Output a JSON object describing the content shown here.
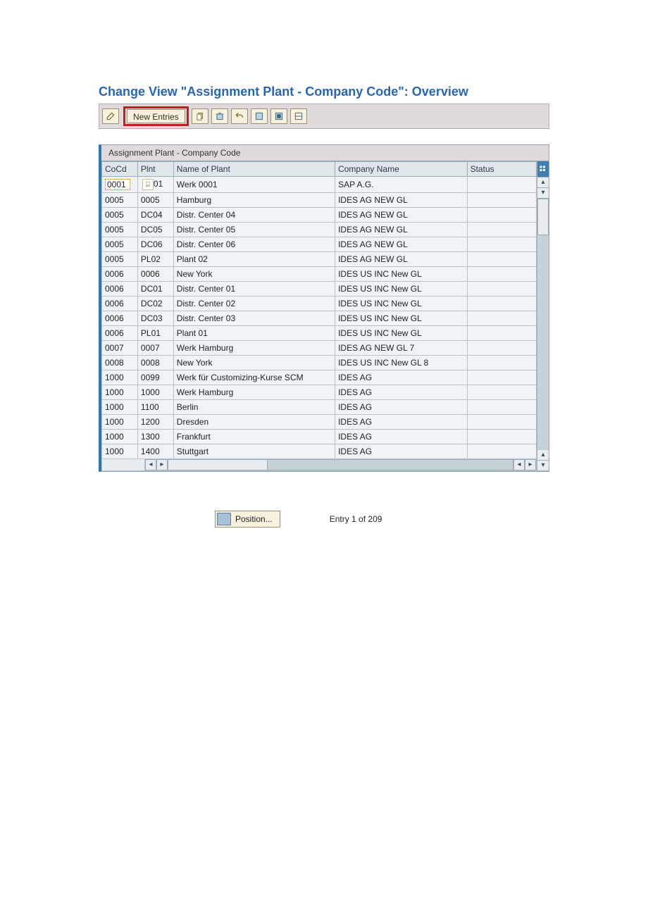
{
  "title": "Change View \"Assignment Plant - Company Code\": Overview",
  "toolbar": {
    "new_entries_label": "New Entries"
  },
  "panel": {
    "header": "Assignment Plant - Company Code",
    "columns": {
      "cocd": "CoCd",
      "plnt": "Plnt",
      "name": "Name of Plant",
      "company": "Company Name",
      "status": "Status"
    }
  },
  "rows": [
    {
      "cocd": "0001",
      "plnt": "01",
      "name": "Werk 0001",
      "company": "SAP A.G.",
      "status": "",
      "editable": true,
      "plnt_prefix": ""
    },
    {
      "cocd": "0005",
      "plnt": "0005",
      "name": "Hamburg",
      "company": "IDES AG NEW GL",
      "status": ""
    },
    {
      "cocd": "0005",
      "plnt": "DC04",
      "name": "Distr. Center 04",
      "company": "IDES AG NEW GL",
      "status": ""
    },
    {
      "cocd": "0005",
      "plnt": "DC05",
      "name": "Distr. Center 05",
      "company": "IDES AG NEW GL",
      "status": ""
    },
    {
      "cocd": "0005",
      "plnt": "DC06",
      "name": "Distr. Center 06",
      "company": "IDES AG NEW GL",
      "status": ""
    },
    {
      "cocd": "0005",
      "plnt": "PL02",
      "name": "Plant 02",
      "company": "IDES AG NEW GL",
      "status": ""
    },
    {
      "cocd": "0006",
      "plnt": "0006",
      "name": "New York",
      "company": "IDES US INC New GL",
      "status": ""
    },
    {
      "cocd": "0006",
      "plnt": "DC01",
      "name": "Distr. Center 01",
      "company": "IDES US INC New GL",
      "status": ""
    },
    {
      "cocd": "0006",
      "plnt": "DC02",
      "name": "Distr. Center 02",
      "company": "IDES US INC New GL",
      "status": ""
    },
    {
      "cocd": "0006",
      "plnt": "DC03",
      "name": "Distr. Center 03",
      "company": "IDES US INC New GL",
      "status": ""
    },
    {
      "cocd": "0006",
      "plnt": "PL01",
      "name": "Plant 01",
      "company": "IDES US INC New GL",
      "status": ""
    },
    {
      "cocd": "0007",
      "plnt": "0007",
      "name": "Werk Hamburg",
      "company": "IDES AG NEW GL 7",
      "status": ""
    },
    {
      "cocd": "0008",
      "plnt": "0008",
      "name": "New York",
      "company": "IDES US INC New GL 8",
      "status": ""
    },
    {
      "cocd": "1000",
      "plnt": "0099",
      "name": "Werk für Customizing-Kurse SCM",
      "company": "IDES AG",
      "status": ""
    },
    {
      "cocd": "1000",
      "plnt": "1000",
      "name": "Werk Hamburg",
      "company": "IDES AG",
      "status": ""
    },
    {
      "cocd": "1000",
      "plnt": "1100",
      "name": "Berlin",
      "company": "IDES AG",
      "status": ""
    },
    {
      "cocd": "1000",
      "plnt": "1200",
      "name": "Dresden",
      "company": "IDES AG",
      "status": ""
    },
    {
      "cocd": "1000",
      "plnt": "1300",
      "name": "Frankfurt",
      "company": "IDES AG",
      "status": ""
    },
    {
      "cocd": "1000",
      "plnt": "1400",
      "name": "Stuttgart",
      "company": "IDES AG",
      "status": ""
    }
  ],
  "footer": {
    "position_label": "Position...",
    "entry_text": "Entry 1 of 209"
  }
}
